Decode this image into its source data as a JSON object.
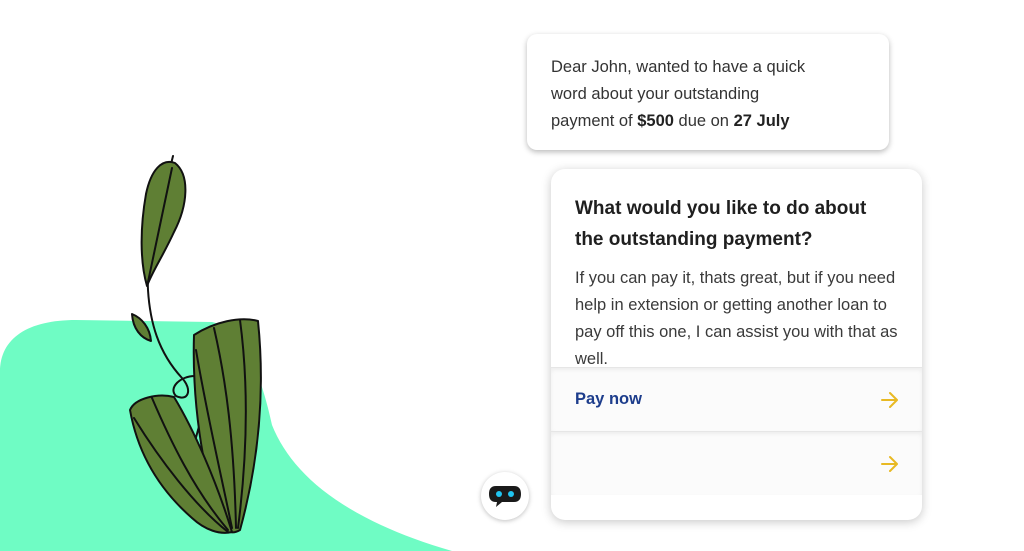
{
  "message": {
    "line1": "Dear John, wanted to have a quick",
    "line2": "word about your outstanding",
    "line3_prefix": "payment of ",
    "amount": "$500",
    "line3_mid": " due on ",
    "due_date": "27 July"
  },
  "card": {
    "title": "What would you like to do about the outstanding payment?",
    "body": "If you can pay it, thats great, but if you need help in extension or getting another loan to pay off this one, I can assist you with that as well.",
    "options": [
      {
        "label": "Pay now",
        "icon": "arrow-right-icon"
      },
      {
        "label": "",
        "icon": "arrow-right-icon"
      }
    ]
  },
  "avatar": {
    "icon": "chatbot-icon"
  },
  "colors": {
    "accent_text": "#1d3d8c",
    "arrow": "#e8b923",
    "blob": "#6ffcc4",
    "leaf": "#5f7f34",
    "bot_eyes": "#20c4f0"
  }
}
